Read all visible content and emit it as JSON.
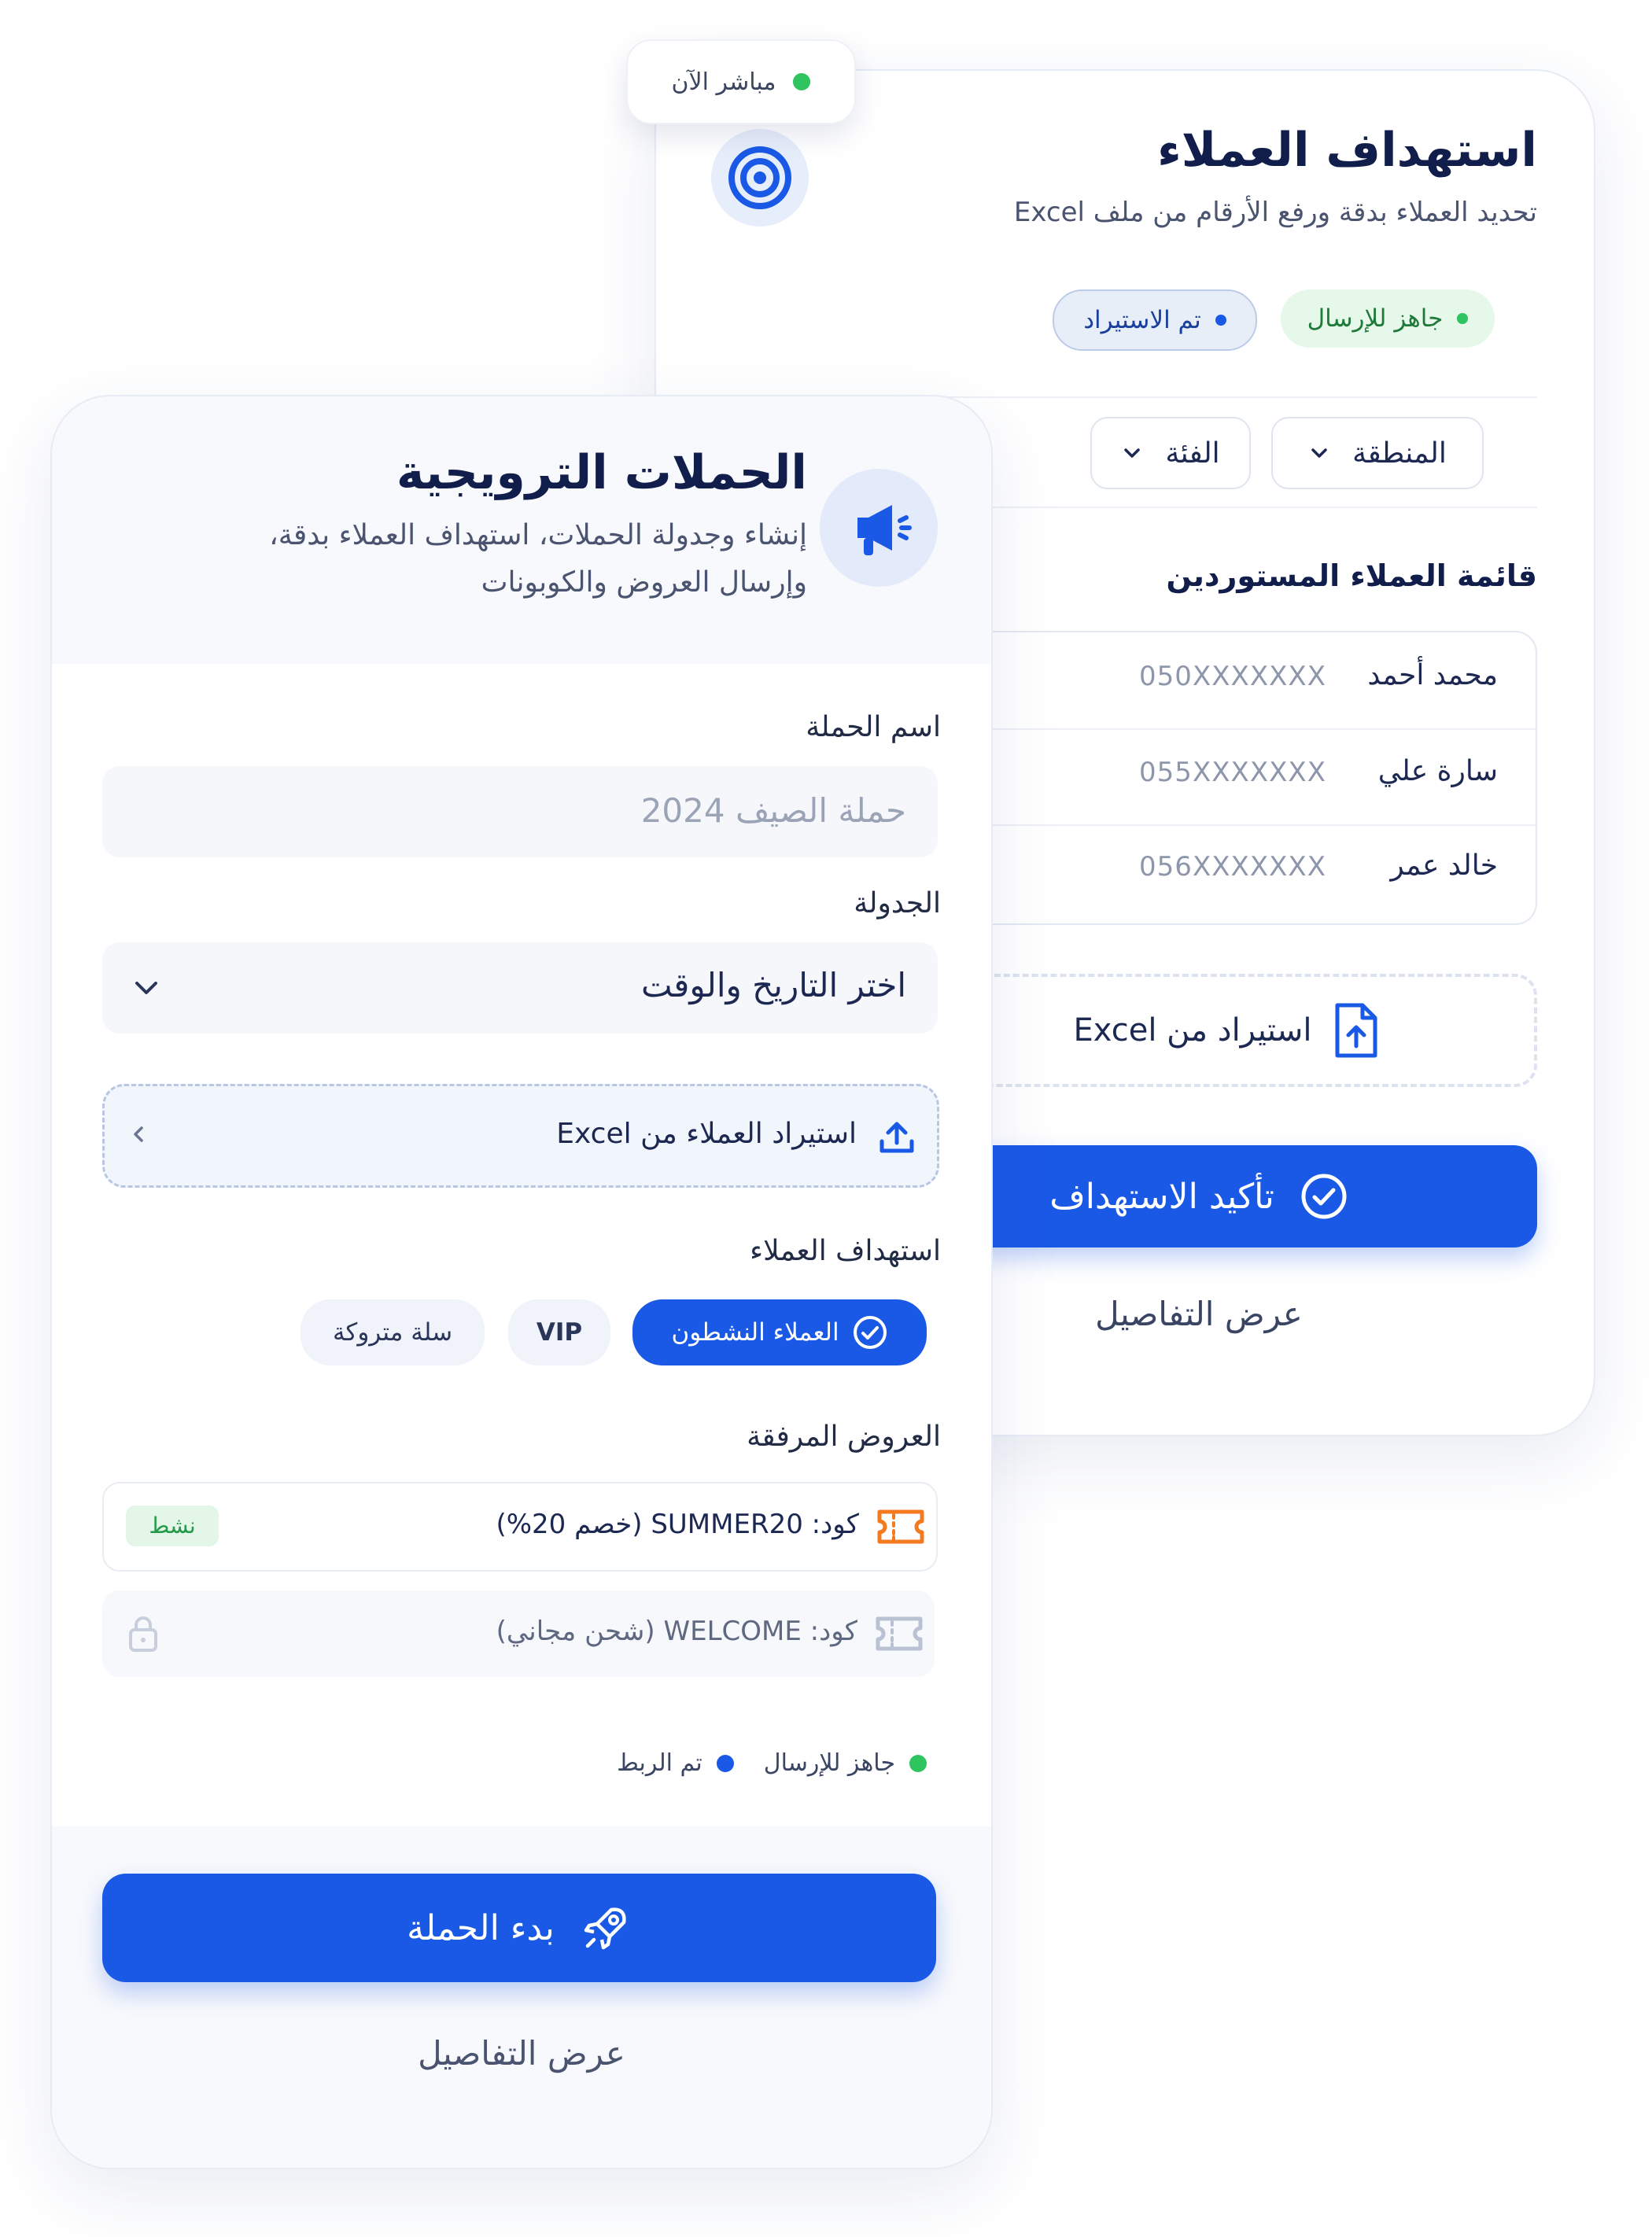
{
  "live_indicator": {
    "label": "مباشر الآن",
    "color": "#2ec45f"
  },
  "targeting_card": {
    "title": "استهداف العملاء",
    "subtitle": "تحديد العملاء بدقة ورفع الأرقام من ملف Excel",
    "icon": "target-icon",
    "badges": [
      {
        "label": "جاهز للإرسال",
        "color": "#2ec45f"
      },
      {
        "label": "تم الاستيراد",
        "color": "#1a59e6"
      }
    ],
    "filters": [
      {
        "label": "المنطقة"
      },
      {
        "label": "الفئة"
      }
    ],
    "list_title": "قائمة العملاء المستوردين",
    "customers": [
      {
        "name": "محمد أحمد",
        "phone": "050XXXXXXX"
      },
      {
        "name": "سارة علي",
        "phone": "055XXXXXXX"
      },
      {
        "name": "خالد عمر",
        "phone": "056XXXXXXX"
      }
    ],
    "import_label": "استيراد من Excel",
    "confirm_label": "تأكيد الاستهداف",
    "details_label": "عرض التفاصيل"
  },
  "campaign_card": {
    "title": "الحملات الترويجية",
    "subtitle_line1": "إنشاء وجدولة الحملات، استهداف العملاء بدقة،",
    "subtitle_line2": "وإرسال العروض والكوبونات",
    "icon": "megaphone-icon",
    "campaign_name_label": "اسم الحملة",
    "campaign_name_placeholder": "حملة الصيف 2024",
    "schedule_label": "الجدولة",
    "schedule_value": "اختر التاريخ والوقت",
    "import_customers_label": "استيراد العملاء من Excel",
    "targeting_label": "استهداف العملاء",
    "segments": [
      {
        "label": "العملاء النشطون",
        "selected": true
      },
      {
        "label": "VIP",
        "selected": false
      },
      {
        "label": "سلة متروكة",
        "selected": false
      }
    ],
    "offers_label": "العروض المرفقة",
    "offers": [
      {
        "text": "كود: SUMMER20 (خصم 20%)",
        "status": "نشط",
        "active": true
      },
      {
        "text": "كود: WELCOME (شحن مجاني)",
        "status": "",
        "active": false
      }
    ],
    "status_legend": [
      {
        "label": "جاهز للإرسال",
        "color": "#2ec45f"
      },
      {
        "label": "تم الربط",
        "color": "#1a59e6"
      }
    ],
    "start_label": "بدء الحملة",
    "details_label": "عرض التفاصيل"
  },
  "colors": {
    "primary": "#1a59e6",
    "success": "#2ec45f",
    "warning": "#f47a20",
    "navy": "#14204a"
  }
}
